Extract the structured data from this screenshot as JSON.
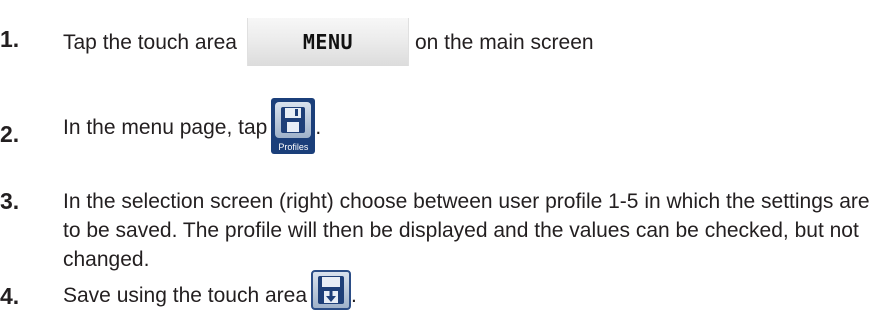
{
  "steps": [
    {
      "number": "1.",
      "text_before": "Tap the touch area",
      "button_label": "MENU",
      "text_after": "on the main screen"
    },
    {
      "number": "2.",
      "text_before": "In the menu page, tap",
      "icon_name": "profiles-floppy-icon",
      "icon_caption": "Profiles",
      "text_after": "."
    },
    {
      "number": "3.",
      "text": "In the selection screen (right) choose between user profile 1-5 in which the settings are to be saved. The profile will then be displayed and the values can be checked, but not changed."
    },
    {
      "number": "4.",
      "text_before": "Save using the touch area",
      "icon_name": "save-floppy-arrow-icon",
      "text_after": "."
    }
  ],
  "colors": {
    "text": "#231f20",
    "icon_frame": "#1b3f7a",
    "icon_fill": "#b8c7da"
  }
}
